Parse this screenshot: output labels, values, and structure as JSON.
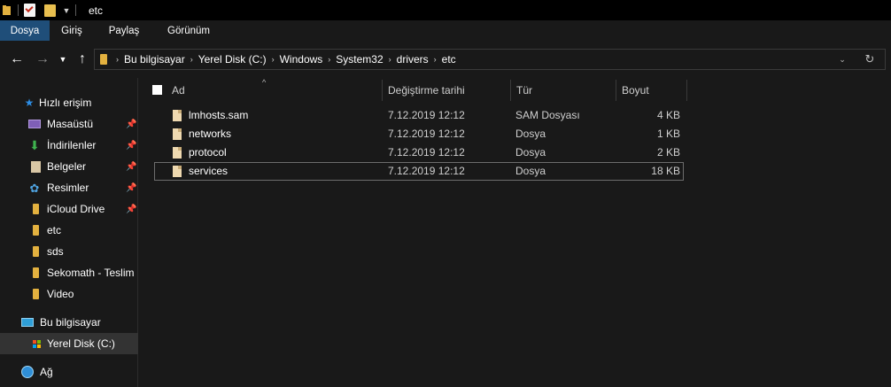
{
  "window": {
    "title": "etc"
  },
  "quick_access": {
    "dropdown_icon": "chevron-down-icon"
  },
  "ribbon": {
    "tabs": [
      "Dosya",
      "Giriş",
      "Paylaş",
      "Görünüm"
    ]
  },
  "navigation": {
    "back_icon": "←",
    "forward_icon": "→",
    "recent_icon": "⌄",
    "up_icon": "↑"
  },
  "address": {
    "crumbs": [
      "Bu bilgisayar",
      "Yerel Disk (C:)",
      "Windows",
      "System32",
      "drivers",
      "etc"
    ],
    "separator": "›",
    "dropdown_icon": "⌄",
    "refresh_icon": "↻"
  },
  "sidebar": {
    "quick_access_label": "Hızlı erişim",
    "items": [
      {
        "label": "Masaüstü",
        "icon": "desktop-icon",
        "pinned": true
      },
      {
        "label": "İndirilenler",
        "icon": "download-icon",
        "pinned": true
      },
      {
        "label": "Belgeler",
        "icon": "documents-icon",
        "pinned": true
      },
      {
        "label": "Resimler",
        "icon": "pictures-icon",
        "pinned": true
      },
      {
        "label": "iCloud Drive",
        "icon": "folder-icon",
        "pinned": true
      },
      {
        "label": "etc",
        "icon": "folder-icon",
        "pinned": false
      },
      {
        "label": "sds",
        "icon": "folder-icon",
        "pinned": false
      },
      {
        "label": "Sekomath - Teslim",
        "icon": "folder-icon",
        "pinned": false
      },
      {
        "label": "Video",
        "icon": "folder-icon",
        "pinned": false
      }
    ],
    "this_pc_label": "Bu bilgisayar",
    "local_disk_label": "Yerel Disk (C:)",
    "network_label": "Ağ",
    "pin_glyph": "📌"
  },
  "file_list": {
    "columns": {
      "name": "Ad",
      "modified": "Değiştirme tarihi",
      "type": "Tür",
      "size": "Boyut"
    },
    "sort_indicator": "^",
    "rows": [
      {
        "name": "lmhosts.sam",
        "modified": "7.12.2019 12:12",
        "type": "SAM Dosyası",
        "size": "4 KB"
      },
      {
        "name": "networks",
        "modified": "7.12.2019 12:12",
        "type": "Dosya",
        "size": "1 KB"
      },
      {
        "name": "protocol",
        "modified": "7.12.2019 12:12",
        "type": "Dosya",
        "size": "2 KB"
      },
      {
        "name": "services",
        "modified": "7.12.2019 12:12",
        "type": "Dosya",
        "size": "18 KB"
      }
    ]
  },
  "colors": {
    "background": "#191919",
    "titlebar": "#000000",
    "active_tab": "#1f4e79",
    "folder": "#e3b13f",
    "selection": "#333333"
  }
}
